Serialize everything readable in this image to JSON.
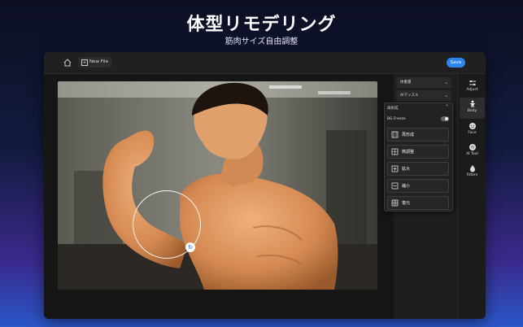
{
  "promo": {
    "headline": "体型リモデリング",
    "subheadline": "筋肉サイズ自由調整"
  },
  "topbar": {
    "new_file_label": "New File",
    "save_label": "Save",
    "accent_color": "#2d86f0"
  },
  "panel": {
    "dropdown_1": "体重量",
    "dropdown_2": "AIマッスル"
  },
  "popup": {
    "header": "再形成",
    "freeze_label": "BG Freeze",
    "freeze_on": false,
    "options": [
      {
        "label": "再形成",
        "icon": "reshape-icon"
      },
      {
        "label": "微調整",
        "icon": "fine-tune-icon"
      },
      {
        "label": "拡大",
        "icon": "enlarge-icon"
      },
      {
        "label": "縮小",
        "icon": "shrink-icon"
      },
      {
        "label": "復元",
        "icon": "restore-icon"
      }
    ]
  },
  "sidebar": {
    "items": [
      {
        "label": "Adjust",
        "icon": "sliders-icon"
      },
      {
        "label": "Body",
        "icon": "body-icon",
        "active": true
      },
      {
        "label": "Face",
        "icon": "face-icon"
      },
      {
        "label": "AI Tool",
        "icon": "ai-tool-icon"
      },
      {
        "label": "Filters",
        "icon": "filters-icon"
      }
    ]
  },
  "canvas": {
    "photo": "shirtless muscular man flexing his bicep in a gym",
    "brush_handle_icon": "refresh-icon"
  },
  "undo_bar": {
    "icons": [
      "undo-icon",
      "redo-icon",
      "compare-icon"
    ]
  }
}
